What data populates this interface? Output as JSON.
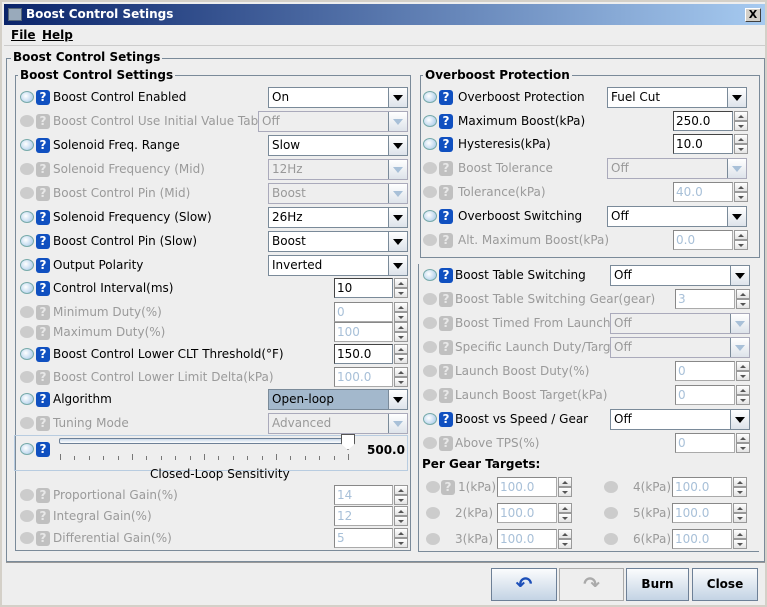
{
  "window": {
    "title": "Boost Control Setings",
    "close": "X"
  },
  "menu": {
    "file": "File",
    "help": "Help"
  },
  "outer_title": "Boost Control Setings",
  "left": {
    "title": "Boost Control Settings",
    "rows": [
      {
        "label": "Boost Control Enabled",
        "type": "combo",
        "value": "On",
        "enabled": true
      },
      {
        "label": "Boost Control Use Initial Value Table",
        "type": "combo",
        "value": "Off",
        "enabled": false
      },
      {
        "label": "Solenoid Freq. Range",
        "type": "combo",
        "value": "Slow",
        "enabled": true
      },
      {
        "label": "Solenoid Frequency (Mid)",
        "type": "combo",
        "value": "12Hz",
        "enabled": false
      },
      {
        "label": "Boost Control Pin (Mid)",
        "type": "combo",
        "value": "Boost",
        "enabled": false
      },
      {
        "label": "Solenoid Frequency (Slow)",
        "type": "combo",
        "value": "26Hz",
        "enabled": true
      },
      {
        "label": "Boost Control Pin (Slow)",
        "type": "combo",
        "value": "Boost",
        "enabled": true
      },
      {
        "label": "Output Polarity",
        "type": "combo",
        "value": "Inverted",
        "enabled": true
      },
      {
        "label": "Control Interval(ms)",
        "type": "spin",
        "value": "10",
        "enabled": true
      },
      {
        "label": "Minimum Duty(%)",
        "type": "spin",
        "value": "0",
        "enabled": false
      },
      {
        "label": "Maximum Duty(%)",
        "type": "spin",
        "value": "100",
        "enabled": false
      },
      {
        "label": "Boost Control Lower CLT Threshold(°F)",
        "type": "spin",
        "value": "150.0",
        "enabled": true
      },
      {
        "label": "Boost Control Lower Limit Delta(kPa)",
        "type": "spin",
        "value": "100.0",
        "enabled": false
      },
      {
        "label": "Algorithm",
        "type": "combo",
        "value": "Open-loop",
        "enabled": true,
        "selected": true
      },
      {
        "label": "Tuning Mode",
        "type": "combo",
        "value": "Advanced",
        "enabled": false
      },
      {
        "label": "Proportional Gain(%)",
        "type": "spin",
        "value": "14",
        "enabled": false
      },
      {
        "label": "Integral Gain(%)",
        "type": "spin",
        "value": "12",
        "enabled": false
      },
      {
        "label": "Differential Gain(%)",
        "type": "spin",
        "value": "5",
        "enabled": false
      }
    ],
    "slider": {
      "label": "Closed-Loop Sensitivity",
      "value": "500.0",
      "fraction": 1.0
    }
  },
  "overboost": {
    "title": "Overboost Protection",
    "rows": [
      {
        "label": "Overboost Protection",
        "type": "combo",
        "value": "Fuel Cut",
        "enabled": true
      },
      {
        "label": "Maximum Boost(kPa)",
        "type": "spin",
        "value": "250.0",
        "enabled": true
      },
      {
        "label": "Hysteresis(kPa)",
        "type": "spin",
        "value": "10.0",
        "enabled": true
      },
      {
        "label": "Boost Tolerance",
        "type": "combo",
        "value": "Off",
        "enabled": false
      },
      {
        "label": "Tolerance(kPa)",
        "type": "spin",
        "value": "40.0",
        "enabled": false
      },
      {
        "label": "Overboost Switching",
        "type": "combo",
        "value": "Off",
        "enabled": true
      },
      {
        "label": "Alt. Maximum Boost(kPa)",
        "type": "spin",
        "value": "0.0",
        "enabled": false
      }
    ]
  },
  "table": {
    "rows": [
      {
        "label": "Boost Table Switching",
        "type": "combo",
        "value": "Off",
        "enabled": true
      },
      {
        "label": "Boost Table Switching Gear(gear)",
        "type": "spin",
        "value": "3",
        "enabled": false
      },
      {
        "label": "Boost Timed From Launch",
        "type": "combo",
        "value": "Off",
        "enabled": false
      },
      {
        "label": "Specific Launch Duty/Target",
        "type": "combo",
        "value": "Off",
        "enabled": false
      },
      {
        "label": "Launch Boost Duty(%)",
        "type": "spin",
        "value": "0",
        "enabled": false
      },
      {
        "label": "Launch Boost Target(kPa)",
        "type": "spin",
        "value": "0",
        "enabled": false
      },
      {
        "label": "Boost vs Speed / Gear",
        "type": "combo",
        "value": "Off",
        "enabled": true
      },
      {
        "label": "Above TPS(%)",
        "type": "spin",
        "value": "0",
        "enabled": false
      }
    ],
    "per_gear_title": "Per Gear Targets:",
    "gears": [
      {
        "label": "1(kPa)",
        "value": "100.0"
      },
      {
        "label": "2(kPa)",
        "value": "100.0"
      },
      {
        "label": "3(kPa)",
        "value": "100.0"
      },
      {
        "label": "4(kPa)",
        "value": "100.0"
      },
      {
        "label": "5(kPa)",
        "value": "100.0"
      },
      {
        "label": "6(kPa)",
        "value": "100.0"
      }
    ]
  },
  "buttons": {
    "undo": "undo-icon",
    "redo": "redo-icon",
    "burn": "Burn",
    "close": "Close"
  }
}
